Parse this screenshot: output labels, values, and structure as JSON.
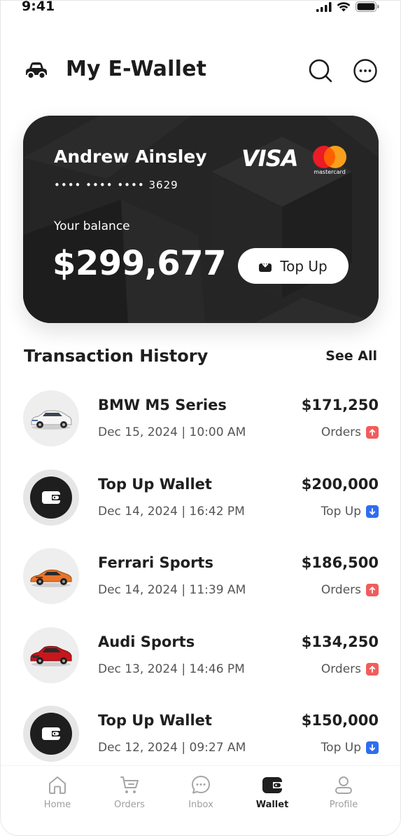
{
  "status_bar": {
    "time": "9:41"
  },
  "header": {
    "title": "My E-Wallet"
  },
  "card": {
    "holder": "Andrew Ainsley",
    "number_masked": "•••• •••• •••• 3629",
    "brand_visa": "VISA",
    "brand_mastercard": "mastercard",
    "balance_label": "Your balance",
    "balance": "$299,677",
    "topup_label": "Top Up"
  },
  "transactions": {
    "title": "Transaction History",
    "see_all": "See All",
    "items": [
      {
        "name": "BMW M5 Series",
        "date": "Dec 15, 2024 | 10:00 AM",
        "amount": "$171,250",
        "type": "Orders",
        "direction": "up",
        "icon": "car-white-icon"
      },
      {
        "name": "Top Up Wallet",
        "date": "Dec 14, 2024 | 16:42 PM",
        "amount": "$200,000",
        "type": "Top Up",
        "direction": "down",
        "icon": "wallet-icon"
      },
      {
        "name": "Ferrari Sports",
        "date": "Dec 14, 2024 | 11:39 AM",
        "amount": "$186,500",
        "type": "Orders",
        "direction": "up",
        "icon": "car-orange-icon"
      },
      {
        "name": "Audi Sports",
        "date": "Dec 13, 2024 | 14:46 PM",
        "amount": "$134,250",
        "type": "Orders",
        "direction": "up",
        "icon": "car-red-icon"
      },
      {
        "name": "Top Up Wallet",
        "date": "Dec 12, 2024 | 09:27 AM",
        "amount": "$150,000",
        "type": "Top Up",
        "direction": "down",
        "icon": "wallet-icon"
      }
    ]
  },
  "nav": {
    "items": [
      {
        "label": "Home",
        "icon": "home-icon",
        "active": false
      },
      {
        "label": "Orders",
        "icon": "cart-icon",
        "active": false
      },
      {
        "label": "Inbox",
        "icon": "chat-icon",
        "active": false
      },
      {
        "label": "Wallet",
        "icon": "wallet-icon",
        "active": true
      },
      {
        "label": "Profile",
        "icon": "user-icon",
        "active": false
      }
    ]
  },
  "colors": {
    "accent_dark": "#1f1f1f",
    "up_badge": "#f25c5c",
    "down_badge": "#2f6df0",
    "card_bg": "#232323"
  }
}
